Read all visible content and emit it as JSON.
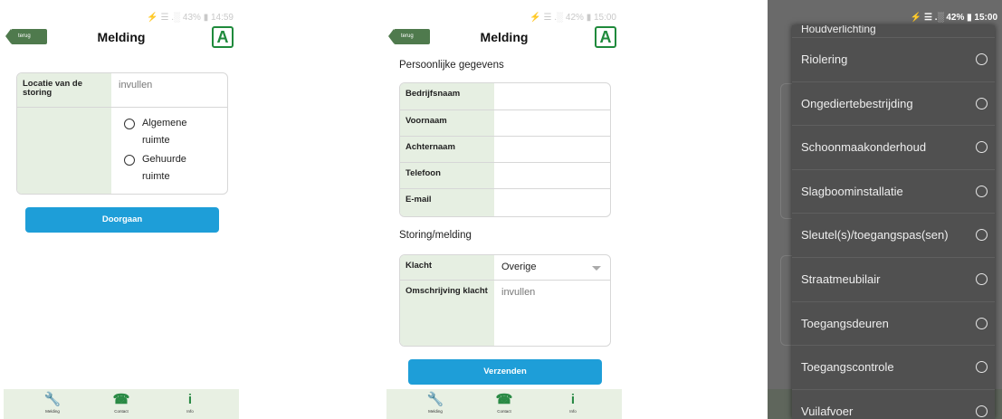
{
  "status_bars": [
    "⚡ ☰ .░ 43% ▮ 14:59",
    "⚡ ☰ .░ 42% ▮ 15:00",
    "⚡ ☰ .░ 42% ▮ 15:00"
  ],
  "header": {
    "back_label": "terug",
    "title": "Melding",
    "logo_letter": "A"
  },
  "screen1": {
    "location_label": "Locatie van de storing",
    "location_placeholder": "invullen",
    "radio_options": [
      "Algemene ruimte",
      "Gehuurde ruimte"
    ],
    "button_label": "Doorgaan"
  },
  "screen2": {
    "section_personal": "Persoonlijke gegevens",
    "fields": [
      "Bedrijfsnaam",
      "Voornaam",
      "Achternaam",
      "Telefoon",
      "E-mail"
    ],
    "section_issue": "Storing/melding",
    "complaint_label": "Klacht",
    "complaint_value": "Overige",
    "description_label": "Omschrijving klacht",
    "description_placeholder": "invullen",
    "button_label": "Verzenden"
  },
  "screen3": {
    "top_partial": "Houdverlichting",
    "items": [
      "Riolering",
      "Ongediertebestrijding",
      "Schoonmaakonderhoud",
      "Slagboominstallatie",
      "Sleutel(s)/toegangspas(sen)",
      "Straatmeubilair",
      "Toegangsdeuren",
      "Toegangscontrole",
      "Vuilafvoer"
    ]
  },
  "nav": {
    "items": [
      "Melding",
      "Contact",
      "Info"
    ]
  },
  "colors": {
    "accent": "#1e9ed8",
    "label_bg": "#e6efe2",
    "brand_green": "#1f8a3c",
    "dialog_bg": "#505050"
  }
}
